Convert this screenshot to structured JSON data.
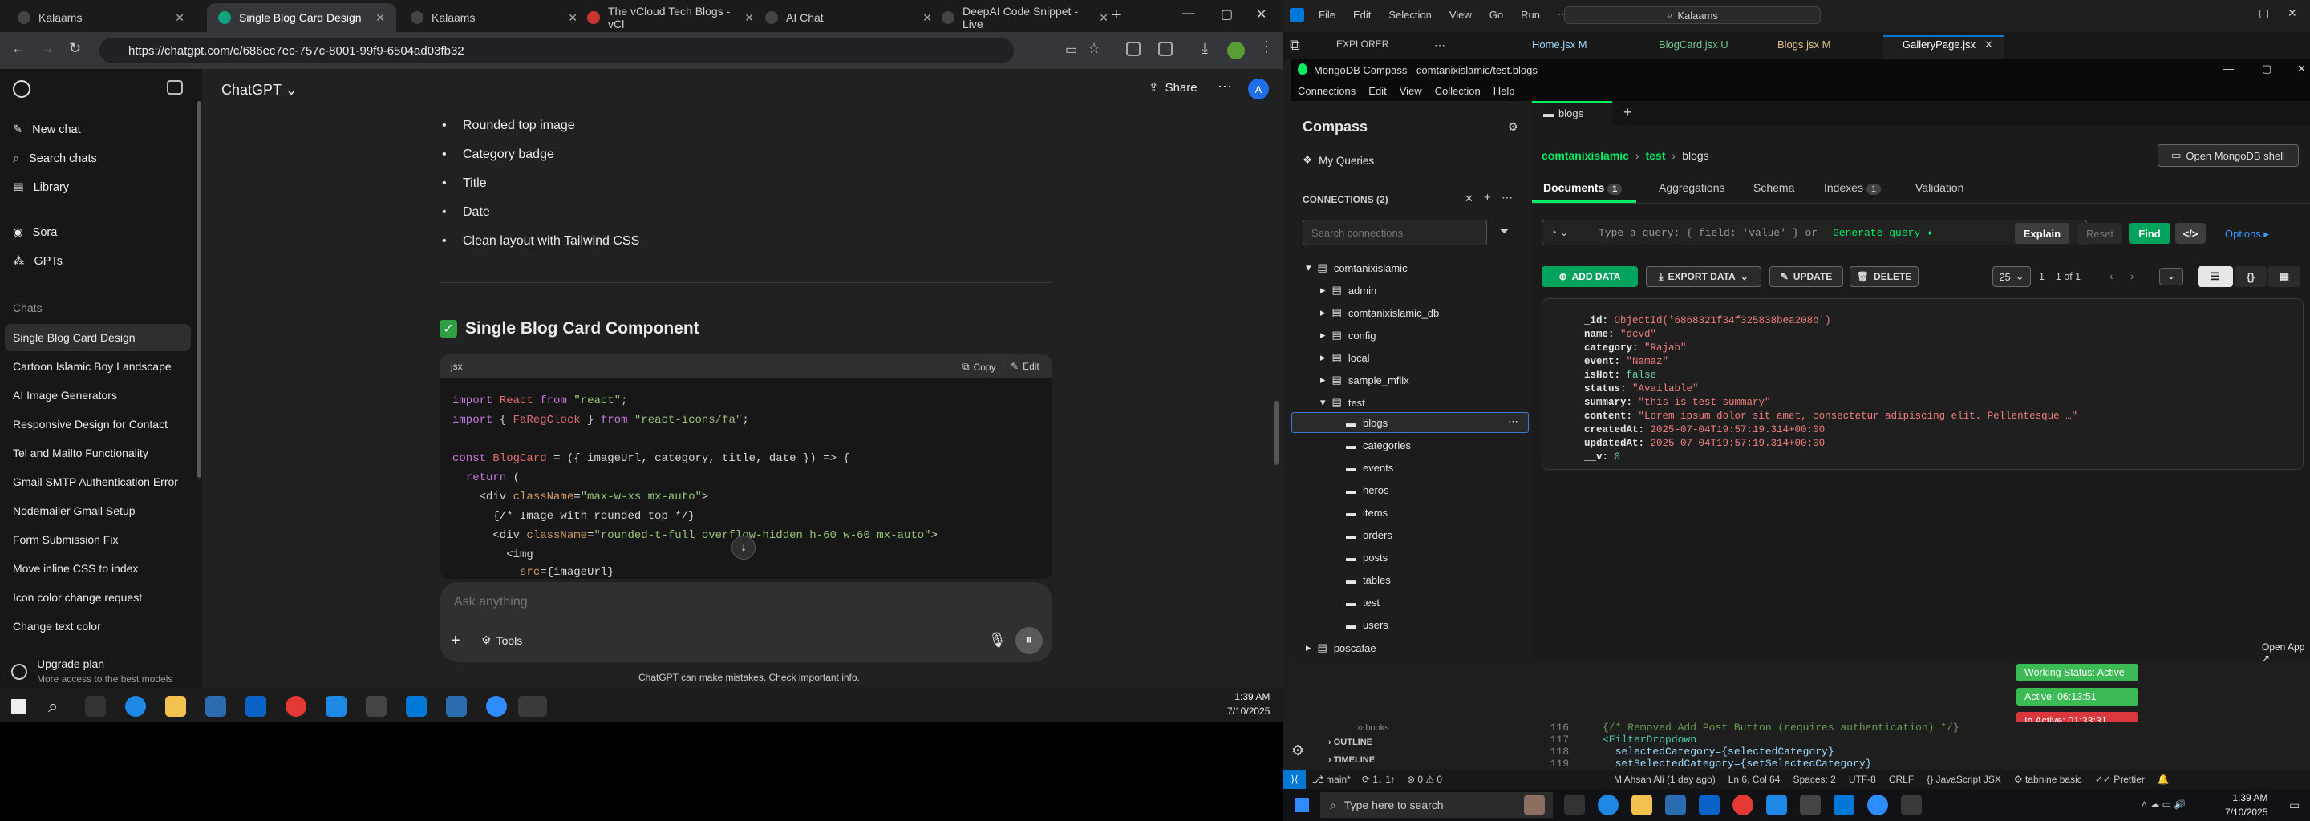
{
  "browser": {
    "tabs": [
      {
        "label": "Kalaams"
      },
      {
        "label": "Single Blog Card Design"
      },
      {
        "label": "Kalaams"
      },
      {
        "label": "The vCloud Tech Blogs - vCl"
      },
      {
        "label": "AI Chat"
      },
      {
        "label": "DeepAI Code Snippet - Live"
      }
    ],
    "url": "https://chatgpt.com/c/686ec7ec-757c-8001-99f9-6504ad03fb32"
  },
  "sidebar": {
    "items": [
      {
        "label": "New chat"
      },
      {
        "label": "Search chats"
      },
      {
        "label": "Library"
      },
      {
        "label": "Sora"
      },
      {
        "label": "GPTs"
      }
    ],
    "chats_heading": "Chats",
    "chats": [
      "Single Blog Card Design",
      "Cartoon Islamic Boy Landscape",
      "AI Image Generators",
      "Responsive Design for Contact",
      "Tel and Mailto Functionality",
      "Gmail SMTP Authentication Error",
      "Nodemailer Gmail Setup",
      "Form Submission Fix",
      "Move inline CSS to index",
      "Icon color change request",
      "Change text color"
    ],
    "upgrade": {
      "title": "Upgrade plan",
      "subtitle": "More access to the best models"
    }
  },
  "header": {
    "model": "ChatGPT",
    "share": "Share",
    "avatar": "A"
  },
  "content": {
    "bullets": [
      "Rounded top image",
      "Category badge",
      "Title",
      "Date",
      "Clean layout with Tailwind CSS"
    ],
    "heading": "Single Blog Card Component",
    "code_lang": "jsx",
    "copy": "Copy",
    "edit": "Edit"
  },
  "composer": {
    "placeholder": "Ask anything",
    "tools": "Tools",
    "disclaimer": "ChatGPT can make mistakes. Check important info."
  },
  "taskbar_left": {
    "time": "1:39 AM",
    "date": "7/10/2025"
  },
  "vscode": {
    "menu": [
      "File",
      "Edit",
      "Selection",
      "View",
      "Go",
      "Run"
    ],
    "search": "Kalaams",
    "explorer": "EXPLORER",
    "tabs": [
      "Home.jsx M",
      "BlogCard.jsx U",
      "Blogs.jsx M",
      "GalleryPage.jsx"
    ]
  },
  "compass": {
    "title": "MongoDB Compass - comtanixislamic/test.blogs",
    "menu": [
      "Connections",
      "Edit",
      "View",
      "Collection",
      "Help"
    ],
    "app": "Compass",
    "my_queries": "My Queries",
    "connections_label": "CONNECTIONS (2)",
    "search_placeholder": "Search connections",
    "tree": [
      {
        "label": "comtanixislamic"
      },
      {
        "label": "admin"
      },
      {
        "label": "comtanixislamic_db"
      },
      {
        "label": "config"
      },
      {
        "label": "local"
      },
      {
        "label": "sample_mflix"
      },
      {
        "label": "test"
      },
      {
        "label": "blogs"
      },
      {
        "label": "categories"
      },
      {
        "label": "events"
      },
      {
        "label": "heros"
      },
      {
        "label": "items"
      },
      {
        "label": "orders"
      },
      {
        "label": "posts"
      },
      {
        "label": "tables"
      },
      {
        "label": "test"
      },
      {
        "label": "users"
      },
      {
        "label": "poscafae"
      }
    ],
    "tab": "blogs",
    "breadcrumb": [
      "comtanixislamic",
      "test",
      "blogs"
    ],
    "open_shell": "Open MongoDB shell",
    "subtabs": [
      {
        "label": "Documents",
        "count": "1"
      },
      {
        "label": "Aggregations"
      },
      {
        "label": "Schema"
      },
      {
        "label": "Indexes",
        "count": "1"
      },
      {
        "label": "Validation"
      }
    ],
    "query_placeholder": "Type a query: { field: 'value' } or",
    "generate": "Generate query",
    "explain": "Explain",
    "reset": "Reset",
    "find": "Find",
    "options": "Options",
    "add_data": "ADD DATA",
    "export_data": "EXPORT DATA",
    "update": "UPDATE",
    "delete": "DELETE",
    "page_size": "25",
    "range": "1 – 1 of 1",
    "doc": [
      {
        "k": "_id",
        "v": "ObjectId('6868321f34f325838bea208b')",
        "t": "s"
      },
      {
        "k": "name",
        "v": "\"dcvd\"",
        "t": "s"
      },
      {
        "k": "category",
        "v": "\"Rajab\"",
        "t": "s"
      },
      {
        "k": "event",
        "v": "\"Namaz\"",
        "t": "s"
      },
      {
        "k": "isHot",
        "v": "false",
        "t": "n"
      },
      {
        "k": "status",
        "v": "\"Available\"",
        "t": "s"
      },
      {
        "k": "summary",
        "v": "\"this is test summary\"",
        "t": "s"
      },
      {
        "k": "content",
        "v": "\"Lorem ipsum dolor sit amet, consectetur adipiscing elit. Pellentesque …\"",
        "t": "s"
      },
      {
        "k": "createdAt",
        "v": "2025-07-04T19:57:19.314+00:00",
        "t": "s"
      },
      {
        "k": "updatedAt",
        "v": "2025-07-04T19:57:19.314+00:00",
        "t": "s"
      },
      {
        "k": "__v",
        "v": "0",
        "t": "n"
      }
    ]
  },
  "tracker": {
    "open_app": "Open App",
    "working": "Working Status: Active",
    "active": "Active: 06:13:51",
    "inactive": "In Active: 01:33:31"
  },
  "editor": {
    "lines": [
      {
        "n": "116",
        "code": "{/* Removed Add Post Button (requires authentication) */}"
      },
      {
        "n": "117",
        "code": "<FilterDropdown"
      },
      {
        "n": "118",
        "code": "  selectedCategory={selectedCategory}"
      },
      {
        "n": "119",
        "code": "  setSelectedCategory={setSelectedCategory}"
      }
    ],
    "outline": "OUTLINE",
    "timeline": "TIMELINE",
    "books": "books"
  },
  "statusbar": {
    "branch": "main*",
    "user": "M Ahsan Ali (1 day ago)",
    "pos": "Ln 6, Col 64",
    "spaces": "Spaces: 2",
    "enc": "UTF-8",
    "eol": "CRLF",
    "lang": "JavaScript JSX",
    "tabnine": "tabnine basic",
    "prettier": "Prettier"
  },
  "taskbar_right": {
    "search": "Type here to search",
    "time": "1:39 AM",
    "date": "7/10/2025"
  },
  "colors": {
    "green": "#00ed64",
    "active_green": "#3cba54",
    "inactive_red": "#d9363e"
  }
}
